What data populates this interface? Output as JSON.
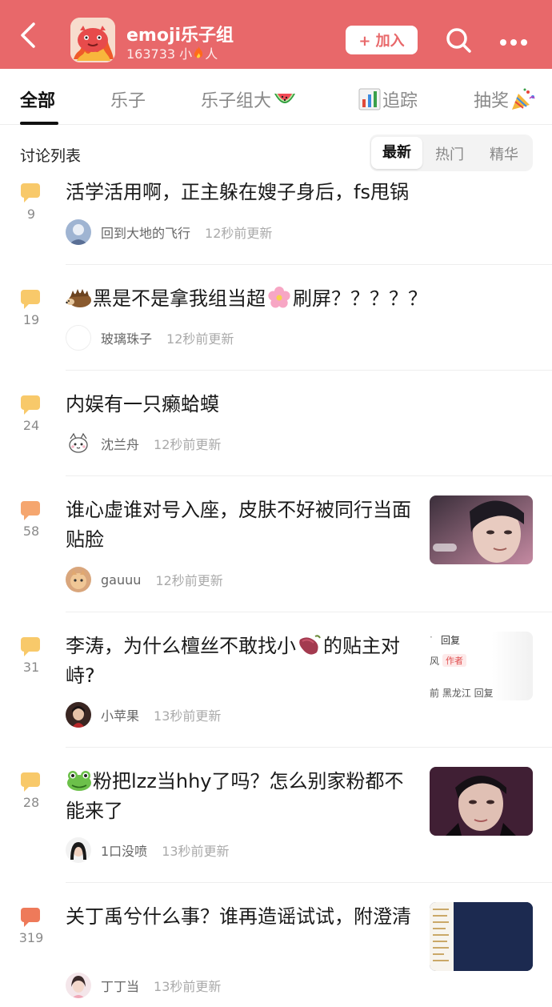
{
  "header": {
    "group_name": "emoji乐子组",
    "member_count": "163733",
    "member_suffix_pre": "小",
    "member_suffix_post": "人",
    "join_label": "+ 加入",
    "bg_color": "#e8686a"
  },
  "tabs": [
    {
      "label": "全部",
      "active": true
    },
    {
      "label": "乐子",
      "active": false
    },
    {
      "label": "乐子组大",
      "emoji": "watermelon-emoji",
      "active": false
    },
    {
      "label": "追踪",
      "emoji": "bar-chart-emoji",
      "active": false
    },
    {
      "label": "抽奖",
      "emoji": "party-popper-emoji",
      "active": false
    }
  ],
  "list": {
    "title": "讨论列表",
    "sort_options": [
      {
        "label": "最新",
        "active": true
      },
      {
        "label": "热门",
        "active": false
      },
      {
        "label": "精华",
        "active": false
      }
    ]
  },
  "posts": [
    {
      "comments": "9",
      "title": "活学活用啊，正主躲在嫂子身后，fs甩锅",
      "author": "回到大地的飞行",
      "time": "12秒前更新"
    },
    {
      "comments": "19",
      "title_parts": [
        "黑是不是拿我组当超",
        "刷屏？？？？？"
      ],
      "author": "玻璃珠子",
      "time": "12秒前更新"
    },
    {
      "comments": "24",
      "title": "内娱有一只癞蛤蟆",
      "author": "沈兰舟",
      "time": "12秒前更新"
    },
    {
      "comments": "58",
      "title": "谁心虚谁对号入座，皮肤不好被同行当面贴脸",
      "author": "gauuu",
      "time": "12秒前更新"
    },
    {
      "comments": "31",
      "title_parts": [
        "李涛，为什么檀丝不敢找小",
        "的贴主对峙?"
      ],
      "author": "小苹果",
      "time": "13秒前更新",
      "thumb_text": {
        "reply": "回复",
        "author_tag": "作者",
        "bottom": "前 黑龙江  回复",
        "left": "风"
      }
    },
    {
      "comments": "28",
      "title_parts": [
        "",
        "粉把lzz当hhy了吗？怎么别家粉都不能来了"
      ],
      "author": "1口没喷",
      "time": "13秒前更新"
    },
    {
      "comments": "319",
      "title": "关丁禹兮什么事？谁再造谣试试，附澄清",
      "author": "丁丁当",
      "time": "13秒前更新"
    }
  ]
}
